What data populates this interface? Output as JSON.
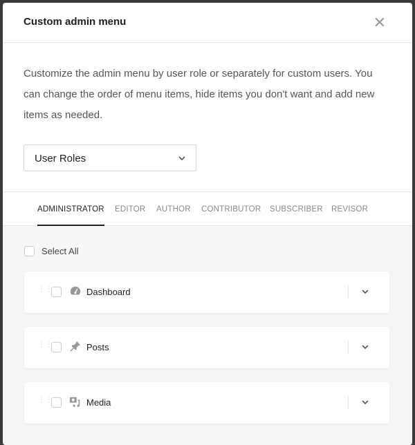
{
  "modal": {
    "title": "Custom admin menu",
    "close_icon": "close-icon",
    "description": "Customize the admin menu by user role or separately for custom users. You can change the order of menu items, hide items you don't want and add new items as needed.",
    "select_value": "User Roles"
  },
  "tabs": [
    {
      "label": "ADMINISTRATOR",
      "active": true
    },
    {
      "label": "EDITOR"
    },
    {
      "label": "AUTHOR"
    },
    {
      "label": "CONTRIBUTOR"
    },
    {
      "label": "SUBSCRIBER"
    },
    {
      "label": "REVISOR"
    }
  ],
  "select_all": "Select All",
  "items": [
    {
      "label": "Dashboard",
      "icon": "dashboard-icon"
    },
    {
      "label": "Posts",
      "icon": "pin-icon"
    },
    {
      "label": "Media",
      "icon": "media-icon"
    }
  ]
}
